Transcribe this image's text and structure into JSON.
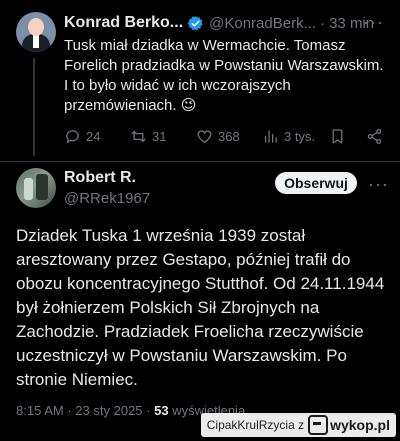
{
  "parent_tweet": {
    "author_name": "Konrad Berko...",
    "handle": "@KonradBerk...",
    "separator": "·",
    "time": "33 min",
    "more": "···",
    "text": "Tusk miał dziadka w Wermachcie. Tomasz Forelich pradziadka w Powstaniu Warszawskim. I to było widać w ich wczorajszych przemówieniach. 😉",
    "actions": {
      "replies": "24",
      "reposts": "31",
      "likes": "368",
      "views": "3 tys."
    }
  },
  "main_tweet": {
    "author_name": "Robert R.",
    "handle": "@RRek1967",
    "follow_label": "Obserwuj",
    "more": "···",
    "text": "Dziadek Tuska 1 września 1939 został aresztowany przez Gestapo, później trafił do obozu koncentracyjnego Stutthof. Od 24.11.1944 był żołnierzem Polskich Sił Zbrojnych na Zachodzie. Pradziadek Froelicha rzeczywiście uczestniczył w Powstaniu Warszawskim. Po stronie Niemiec.",
    "time": "8:15 AM",
    "date": "23 sty 2025",
    "separator": "·",
    "views_count": "53",
    "views_label": "wyświetlenia"
  },
  "watermark": {
    "source_text": "CipakKrulRzycia z",
    "logo_text": "wykop.pl"
  },
  "colors": {
    "background": "#000000",
    "text": "#e7e9ea",
    "muted": "#71767b",
    "verified_blue": "#1d9bf0",
    "follow_bg": "#eff3f4"
  }
}
